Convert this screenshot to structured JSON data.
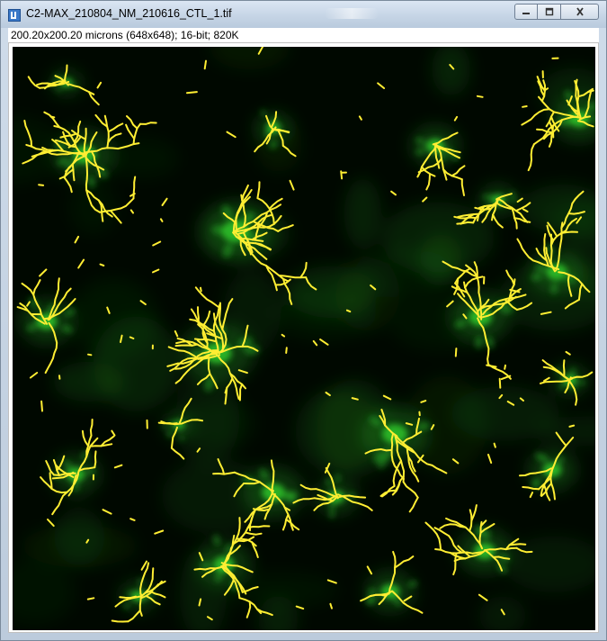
{
  "window": {
    "title": "C2-MAX_210804_NM_210616_CTL_1.tif",
    "app_icon": "imagej-icon",
    "controls": {
      "minimize": "minimize-icon",
      "maximize": "maximize-icon",
      "close": "close-icon"
    }
  },
  "image_info": {
    "text": "200.20x200.20 microns (648x648); 16-bit; 820K"
  },
  "colors": {
    "background": "#000800",
    "cell_fluorescence": "#2fbf2a",
    "skeleton_overlay": "#ffee33"
  }
}
